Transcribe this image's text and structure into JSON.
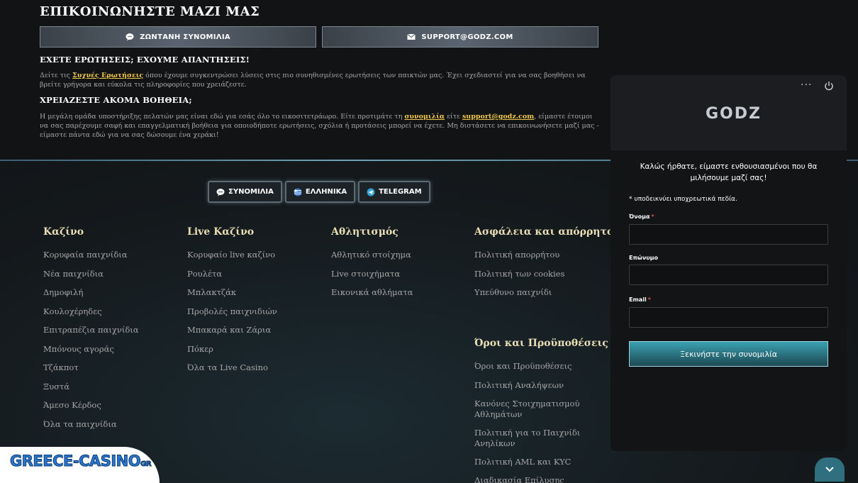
{
  "contact": {
    "title": "ΕΠΙΚΟΙΝΩΝΗΣΤΕ ΜΑΖΙ ΜΑΣ",
    "live_chat_label": "ΖΩΝΤΑΝΗ ΣΥΝΟΜΙΛΙΑ",
    "email_label": "SUPPORT@GODZ.COM",
    "q1_title": "ΕΧΕΤΕ ΕΡΩΤΗΣΕΙΣ; ΕΧΟΥΜΕ ΑΠΑΝΤΗΣΕΙΣ!",
    "q1_text_before": "Δείτε τις ",
    "q1_link": "Συχνές Ερωτήσεις",
    "q1_text_after": " όπου έχουμε συγκεντρώσει λύσεις στις πιο συνηθισμένες ερωτήσεις των παικτών μας. Έχει σχεδιαστεί για να σας βοηθήσει να βρείτε γρήγορα και εύκολα τις πληροφορίες που χρειάζεστε.",
    "q2_title": "ΧΡΕΙΑΖΕΣΤΕ ΑΚΟΜΑ ΒΟΗΘΕΙΑ;",
    "q2_text_before": "Η μεγάλη ομάδα υποστήριξης πελατών μας είναι εδώ για εσάς όλο το εικοσιτετράωρο. Είτε προτιμάτε τη ",
    "q2_link_chat": "συνομιλία",
    "q2_text_mid": " είτε ",
    "q2_link_email": "support@godz.com",
    "q2_text_after": ", είμαστε έτοιμοι να σας παρέχουμε σαφή και επαγγελματική βοήθεια για οποιοδήποτε ερωτήσεις, σχόλια ή προτάσεις μπορεί να έχετε. Μη διστάσετε να επικοινωνήσετε μαζί μας - είμαστε πάντα εδώ για να σας δώσουμε ένα χεράκι!"
  },
  "pills": {
    "chat": "ΣΥΝΟΜΙΛΙΑ",
    "language": "ΕΛΛΗΝΙΚΑ",
    "telegram": "TELEGRAM"
  },
  "footer": {
    "casino": {
      "title": "Καζίνο",
      "links": [
        "Κορυφαία παιχνίδια",
        "Νέα παιχνίδια",
        "Δημοφιλή",
        "Κουλοχέρηδες",
        "Επιτραπέζια παιχνίδια",
        "Μπόνους αγοράς",
        "Τζάκποτ",
        "Ξυστά",
        "Άμεσο Κέρδος",
        "Όλα τα παιχνίδια"
      ]
    },
    "live": {
      "title": "Live Καζίνο",
      "links": [
        "Κορυφαίο live καζίνο",
        "Ρουλέτα",
        "Μπλακτζάκ",
        "Προβολές παιχνιδιών",
        "Μπακαρά και Ζάρια",
        "Πόκερ",
        "Όλα τα Live Casino"
      ]
    },
    "sports": {
      "title": "Αθλητισμός",
      "links": [
        "Αθλητικό στοίχημα",
        "Live στοιχήματα",
        "Εικονικά αθλήματα"
      ]
    },
    "security": {
      "title": "Ασφάλεια και απόρρητο",
      "links": [
        "Πολιτική απορρήτου",
        "Πολιτική των cookies",
        "Υπεύθυνο παιχνίδι"
      ]
    },
    "terms": {
      "title": "Όροι και Προϋποθέσεις",
      "links": [
        "Όροι και Προϋποθέσεις",
        "Πολιτική Αναλήψεων",
        "Κανόνες Στοιχηματισμού Αθλημάτων",
        "Πολιτική για το Παιχνίδι Ανηλίκων",
        "Πολιτική AML και KYC",
        "Διαδικασία Επίλυσης"
      ]
    }
  },
  "chat": {
    "menu_dots": "···",
    "logo": "GODZ",
    "welcome": "Καλώς ήρθατε, είμαστε ενθουσιασμένοι που θα μιλήσουμε μαζί σας!",
    "required_note": "* υποδεικνύει υποχρεωτικά πεδία.",
    "name_label": "Όνομα",
    "surname_label": "Επώνυμο",
    "email_label": "Email",
    "required_star": "*",
    "start_button": "Ξεκινήστε την συνομιλία"
  },
  "brand": {
    "name": "GREECE-CASINO",
    "suffix": "GR"
  },
  "colors": {
    "accent_gold": "#f0c84a",
    "button_teal": "#2a6f7c",
    "heading": "#e9dfb5"
  }
}
